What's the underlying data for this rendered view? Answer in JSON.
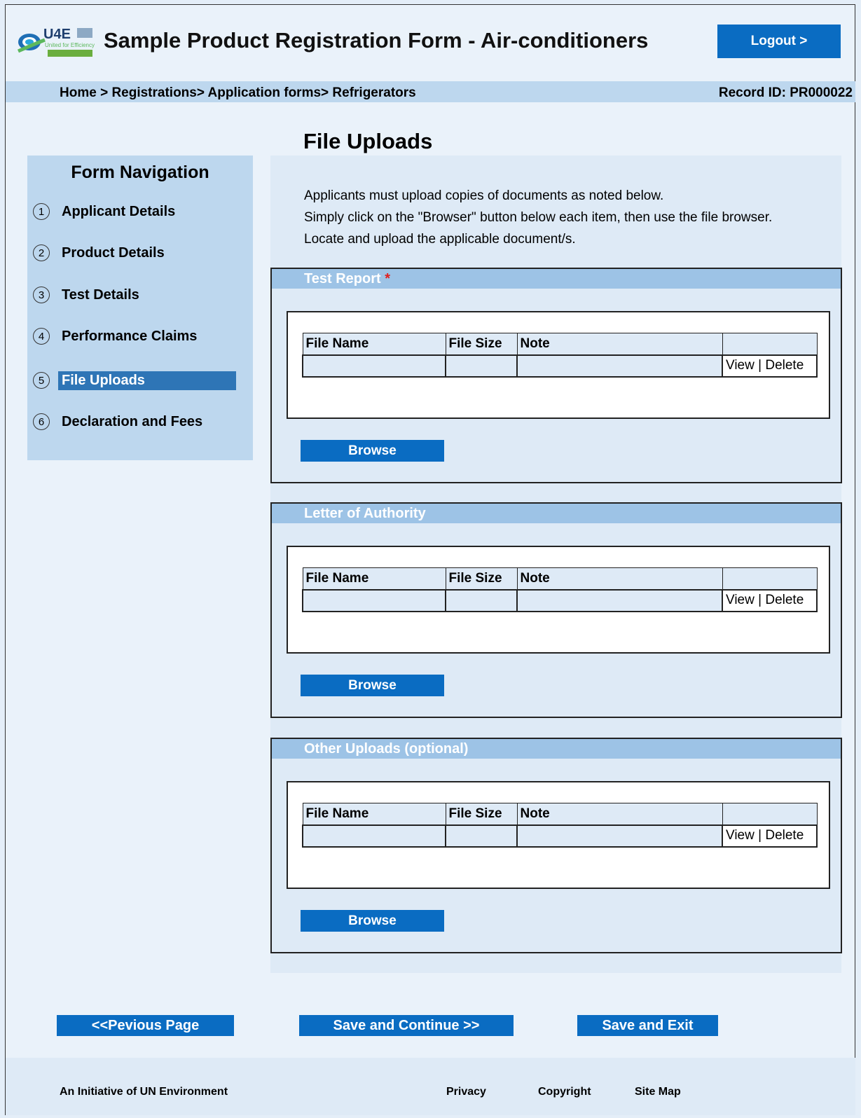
{
  "header": {
    "logo_text": "U4E",
    "logo_sub": "United for Efficiency",
    "app_title": "Sample Product Registration Form - Air-conditioners",
    "logout_label": "Logout >"
  },
  "breadcrumb": {
    "path": "Home > Registrations> Application forms> Refrigerators",
    "record_id": "Record ID: PR000022"
  },
  "page_title": "File Uploads",
  "sidebar": {
    "title": "Form Navigation",
    "items": [
      {
        "num": "1",
        "label": "Applicant Details"
      },
      {
        "num": "2",
        "label": "Product Details"
      },
      {
        "num": "3",
        "label": "Test Details"
      },
      {
        "num": "4",
        "label": "Performance Claims"
      },
      {
        "num": "5",
        "label": "File Uploads"
      },
      {
        "num": "6",
        "label": "Declaration and Fees"
      }
    ],
    "active_index": 4
  },
  "intro": {
    "line1": "Applicants must upload copies of documents as noted below.",
    "line2": "Simply click on the \"Browser\" button below each item, then use the file browser.",
    "line3": "Locate and upload the applicable document/s."
  },
  "table_headers": {
    "file_name": "File Name",
    "file_size": "File Size",
    "note": "Note"
  },
  "row_actions": {
    "view": "View",
    "separator": "|",
    "delete": "Delete"
  },
  "sections": [
    {
      "title": "Test Report",
      "required_mark": "*",
      "browse_label": "Browse"
    },
    {
      "title": "Letter of Authority",
      "browse_label": "Browse"
    },
    {
      "title": "Other Uploads (optional)",
      "browse_label": "Browse"
    }
  ],
  "buttons": {
    "previous": "<<Pevious Page",
    "save_continue": "Save and Continue >>",
    "save_exit": "Save and Exit"
  },
  "footer": {
    "initiative": "An Initiative of UN Environment",
    "privacy": "Privacy",
    "copyright": "Copyright",
    "sitemap": "Site Map"
  },
  "colors": {
    "primary_button": "#0a6cc2",
    "active_nav": "#2e75b6",
    "section_header": "#9dc3e6",
    "bar": "#bdd7ee",
    "required": "#e02020"
  }
}
